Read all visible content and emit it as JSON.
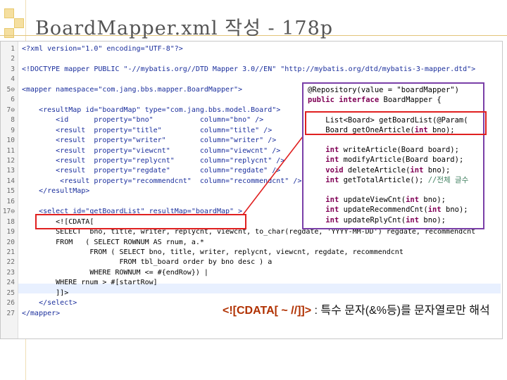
{
  "slide": {
    "title": "BoardMapper.xml 작성 - 178p"
  },
  "editor": {
    "lines": [
      {
        "n": "1",
        "text": "<?xml version=\"1.0\" encoding=\"UTF-8\"?>"
      },
      {
        "n": "2",
        "text": ""
      },
      {
        "n": "3",
        "text": "<!DOCTYPE mapper PUBLIC \"-//mybatis.org//DTD Mapper 3.0//EN\" \"http://mybatis.org/dtd/mybatis-3-mapper.dtd\">"
      },
      {
        "n": "4",
        "text": ""
      },
      {
        "n": "5⊖",
        "text": "<mapper namespace=\"com.jang.bbs.mapper.BoardMapper\">"
      },
      {
        "n": "6",
        "text": ""
      },
      {
        "n": "7⊖",
        "text": "    <resultMap id=\"boardMap\" type=\"com.jang.bbs.model.Board\">"
      },
      {
        "n": "8",
        "text": "        <id      property=\"bno\"           column=\"bno\" />"
      },
      {
        "n": "9",
        "text": "        <result  property=\"title\"         column=\"title\" />"
      },
      {
        "n": "10",
        "text": "        <result  property=\"writer\"        column=\"writer\" />"
      },
      {
        "n": "11",
        "text": "        <result  property=\"viewcnt\"       column=\"viewcnt\" />"
      },
      {
        "n": "12",
        "text": "        <result  property=\"replycnt\"      column=\"replycnt\" />"
      },
      {
        "n": "13",
        "text": "        <result  property=\"regdate\"       column=\"regdate\" />"
      },
      {
        "n": "14",
        "text": "         <result property=\"recommendcnt\"  column=\"recommendcnt\" />"
      },
      {
        "n": "15",
        "text": "    </resultMap>"
      },
      {
        "n": "16",
        "text": ""
      },
      {
        "n": "17⊖",
        "text": "    <select id=\"getBoardList\" resultMap=\"boardMap\" >"
      },
      {
        "n": "18",
        "text": "        <![CDATA["
      },
      {
        "n": "19",
        "text": "        SELECT  bno, title, writer, replycnt, viewcnt, to_char(regdate, 'YYYY-MM-DD') regdate, recommendcnt"
      },
      {
        "n": "20",
        "text": "        FROM   ( SELECT ROWNUM AS rnum, a.*"
      },
      {
        "n": "21",
        "text": "                FROM ( SELECT bno, title, writer, replycnt, viewcnt, regdate, recommendcnt"
      },
      {
        "n": "22",
        "text": "                       FROM tbl_board order by bno desc ) a"
      },
      {
        "n": "23",
        "text": "                WHERE ROWNUM <= #{endRow}) |"
      },
      {
        "n": "24",
        "text": "        WHERE rnum > #[startRow]"
      },
      {
        "n": "25",
        "text": "        ]]>"
      },
      {
        "n": "26",
        "text": "    </select>"
      },
      {
        "n": "27",
        "text": "</mapper>"
      }
    ]
  },
  "interface_box": {
    "lines": [
      "@Repository(value = \"boardMapper\")",
      "public interface BoardMapper {",
      "",
      "    List<Board> getBoardList(@Param(",
      "    Board getOneArticle(int bno);",
      "",
      "    int writeArticle(Board board);",
      "    int modifyArticle(Board board);",
      "    void deleteArticle(int bno);",
      "    int getTotalArticle(); //전체 글수",
      "",
      "    int updateViewCnt(int bno);",
      "    int updateRecommendCnt(int bno);",
      "    int updateRplyCnt(int bno);"
    ]
  },
  "note": {
    "cdata": "<![CDATA[  ~   //]]>",
    "desc": " : 특수 문자(&%등)를 문자열로만 해석"
  },
  "colors": {
    "highlight_red": "#e02020",
    "interface_border": "#7a3fa8"
  }
}
